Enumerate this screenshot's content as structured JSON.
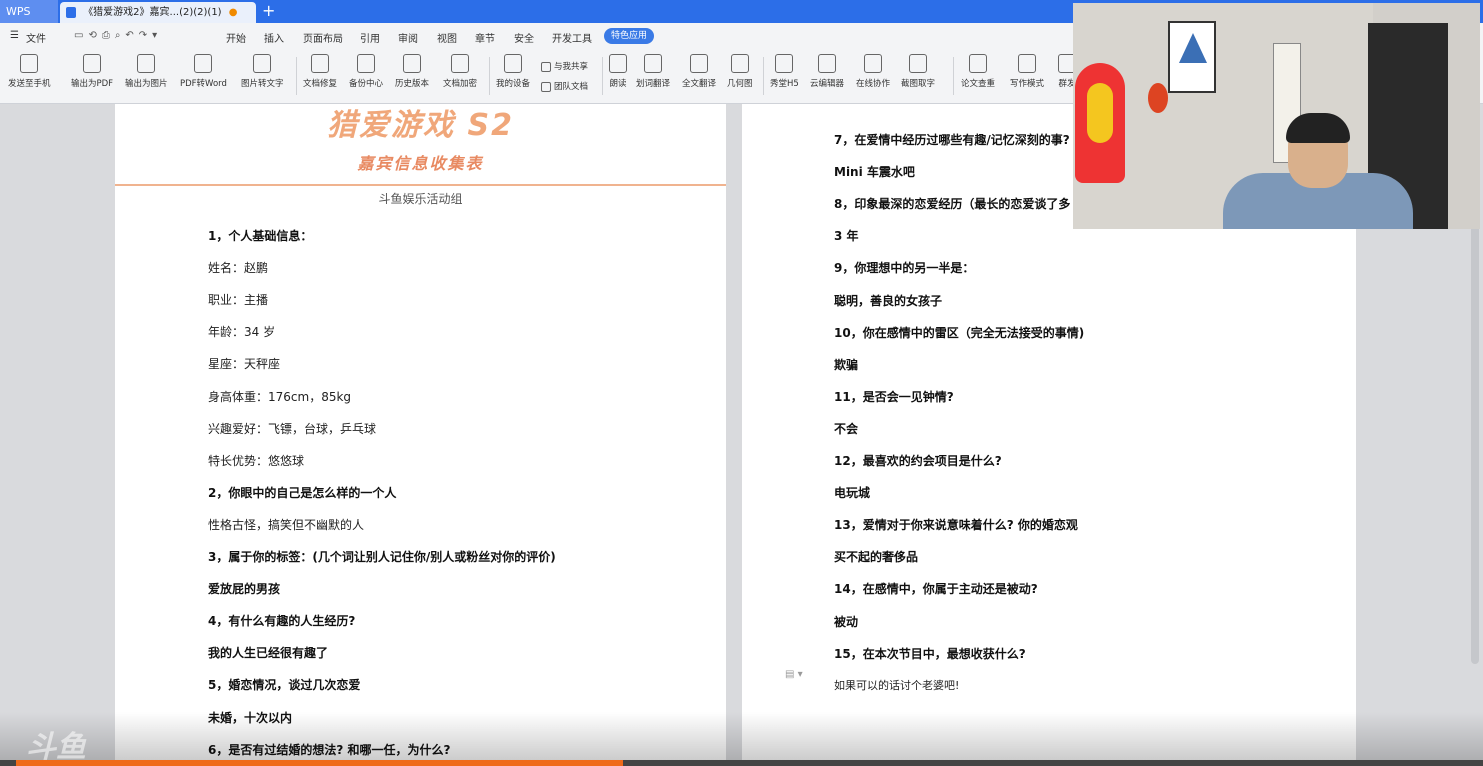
{
  "tabs": {
    "app": "WPS",
    "document": "《猎爱游戏2》嘉宾...(2)(2)(1)",
    "new_tab": "+"
  },
  "menu": [
    "文件",
    "开始",
    "插入",
    "页面布局",
    "引用",
    "审阅",
    "视图",
    "章节",
    "安全",
    "开发工具",
    "特色应用"
  ],
  "toolbar": [
    "发送至手机",
    "输出为PDF",
    "输出为图片",
    "PDF转Word",
    "图片转文字",
    "文档修复",
    "备份中心",
    "历史版本",
    "文档加密",
    "我的设备",
    "与我共享",
    "团队文档",
    "朗读",
    "划词翻译",
    "全文翻译",
    "几何图",
    "秀堂H5",
    "云编辑器",
    "在线协作",
    "截图取字",
    "论文查重",
    "写作模式",
    "群发"
  ],
  "doc_left": {
    "title": "猎爱游戏 S2",
    "subtitle": "嘉宾信息收集表",
    "org": "斗鱼娱乐活动组",
    "lines": [
      {
        "t": "1，个人基础信息：",
        "b": true
      },
      {
        "t": "姓名：赵鹏",
        "b": false
      },
      {
        "t": "职业：主播",
        "b": false
      },
      {
        "t": "年龄：34 岁",
        "b": false
      },
      {
        "t": "星座：天秤座",
        "b": false
      },
      {
        "t": "身高体重：176cm，85kg",
        "b": false
      },
      {
        "t": "兴趣爱好：飞镖，台球，乒乓球",
        "b": false
      },
      {
        "t": "特长优势：悠悠球",
        "b": false
      },
      {
        "t": "2，你眼中的自己是怎么样的一个人",
        "b": true
      },
      {
        "t": "性格古怪，搞笑但不幽默的人",
        "b": false
      },
      {
        "t": "3，属于你的标签：(几个词让别人记住你/别人或粉丝对你的评价)",
        "b": true
      },
      {
        "t": "爱放屁的男孩",
        "b": true
      },
      {
        "t": "4，有什么有趣的人生经历?",
        "b": true
      },
      {
        "t": "我的人生已经很有趣了",
        "b": true
      },
      {
        "t": "5，婚恋情况，谈过几次恋爱",
        "b": true
      },
      {
        "t": "未婚，十次以内",
        "b": true
      },
      {
        "t": "6，是否有过结婚的想法? 和哪一任，为什么?",
        "b": true
      }
    ]
  },
  "doc_right": {
    "lines": [
      {
        "t": "7，在爱情中经历过哪些有趣/记忆深刻的事?",
        "b": true
      },
      {
        "t": "Mini 车震水吧",
        "b": true
      },
      {
        "t": "8，印象最深的恋爱经历（最长的恋爱谈了多",
        "b": true
      },
      {
        "t": "3 年",
        "b": true
      },
      {
        "t": "9，你理想中的另一半是：",
        "b": true
      },
      {
        "t": "聪明，善良的女孩子",
        "b": true
      },
      {
        "t": "10，你在感情中的雷区（完全无法接受的事情)",
        "b": true
      },
      {
        "t": "欺骗",
        "b": true
      },
      {
        "t": "11，是否会一见钟情?",
        "b": true
      },
      {
        "t": "不会",
        "b": true
      },
      {
        "t": "12，最喜欢的约会项目是什么?",
        "b": true
      },
      {
        "t": "电玩城",
        "b": true
      },
      {
        "t": "13，爱情对于你来说意味着什么? 你的婚恋观",
        "b": true
      },
      {
        "t": "买不起的奢侈品",
        "b": true
      },
      {
        "t": "14，在感情中，你属于主动还是被动?",
        "b": true
      },
      {
        "t": "被动",
        "b": true
      },
      {
        "t": "15，在本次节目中，最想收获什么?",
        "b": true
      },
      {
        "t": "如果可以的话讨个老婆吧!",
        "b": false
      }
    ]
  },
  "watermark": "斗鱼",
  "video": {
    "progress": 0.42
  },
  "colors": {
    "accent": "#2c6ee8",
    "title": "#f0a77a",
    "seek": "#ef6a1a"
  }
}
